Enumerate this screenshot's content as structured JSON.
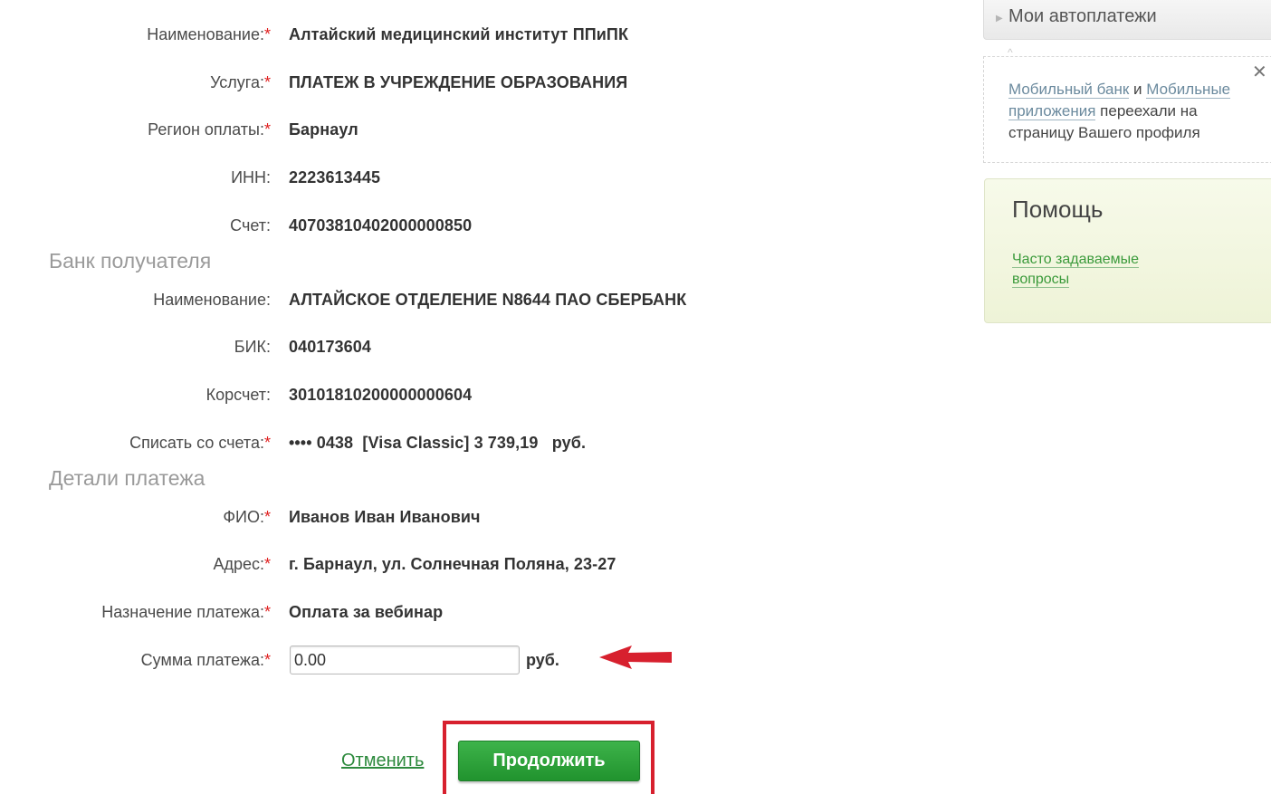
{
  "recipient": {
    "name_label": "Наименование:",
    "name_value": "Алтайский медицинский институт ППиПК",
    "service_label": "Услуга:",
    "service_value": "ПЛАТЕЖ В УЧРЕЖДЕНИЕ ОБРАЗОВАНИЯ",
    "region_label": "Регион оплаты:",
    "region_value": "Барнаул",
    "inn_label": "ИНН:",
    "inn_value": "2223613445",
    "account_label": "Счет:",
    "account_value": "40703810402000000850"
  },
  "bank": {
    "section_title": "Банк получателя",
    "name_label": "Наименование:",
    "name_value": "АЛТАЙСКОЕ ОТДЕЛЕНИЕ N8644 ПАО СБЕРБАНК",
    "bik_label": "БИК:",
    "bik_value": "040173604",
    "corr_label": "Корсчет:",
    "corr_value": "30101810200000000604",
    "debit_label": "Списать со счета:",
    "debit_value": "•••• 0438  [Visa Classic] 3 739,19   руб."
  },
  "details": {
    "section_title": "Детали платежа",
    "fio_label": "ФИО:",
    "fio_value": "Иванов Иван Иванович",
    "address_label": "Адрес:",
    "address_value": "г. Барнаул, ул. Солнечная Поляна, 23-27",
    "purpose_label": "Назначение платежа:",
    "purpose_value": "Оплата за вебинар",
    "amount_label": "Сумма платежа:",
    "amount_value": "0.00",
    "amount_unit": "руб."
  },
  "required_mark": "*",
  "actions": {
    "cancel_label": "Отменить",
    "continue_label": "Продолжить"
  },
  "sidebar": {
    "autopay_label": "Мои автоплатежи",
    "notice": {
      "link1": "Мобильный банк",
      "conj": " и ",
      "link2": "Мобильные приложения",
      "text": " переехали на страницу Вашего профиля",
      "close": "✕"
    },
    "help": {
      "title": "Помощь",
      "faq_label": "Часто задаваемые вопросы"
    }
  },
  "colors": {
    "required": "#e02020",
    "primary_button": "#2a9e37",
    "highlight": "#d7202e",
    "link": "#2d8a3d"
  },
  "icons": {
    "arrow": "red-arrow-left-icon",
    "close": "close-icon",
    "chevron": "chevron-right-icon"
  }
}
